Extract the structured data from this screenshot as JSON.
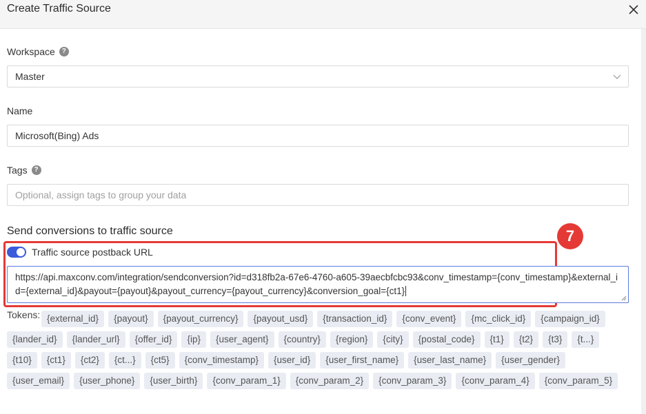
{
  "modal": {
    "title": "Create Traffic Source",
    "close_icon": "close-icon"
  },
  "workspace": {
    "label": "Workspace",
    "help_icon": "question-icon",
    "value": "Master",
    "dropdown_icon": "chevron-down-icon"
  },
  "name": {
    "label": "Name",
    "value": "Microsoft(Bing) Ads"
  },
  "tags": {
    "label": "Tags",
    "help_icon": "question-icon",
    "placeholder": "Optional, assign tags to group your data"
  },
  "conversions": {
    "section_title": "Send conversions to traffic source",
    "toggle_label": "Traffic source postback URL",
    "toggle_on": true,
    "postback_url": "https://api.maxconv.com/integration/sendconversion?id=d318fb2a-67e6-4760-a605-39aecbfcbc93&conv_timestamp={conv_timestamp}&external_id={external_id}&payout={payout}&payout_currency={payout_currency}&conversion_goal={ct1}",
    "step_badge": "7",
    "highlight_color": "#e53935",
    "accent_color": "#3b5bdb"
  },
  "tokens": {
    "label": "Tokens:",
    "items": [
      "{external_id}",
      "{payout}",
      "{payout_currency}",
      "{payout_usd}",
      "{transaction_id}",
      "{conv_event}",
      "{mc_click_id}",
      "{campaign_id}",
      "{lander_id}",
      "{lander_url}",
      "{offer_id}",
      "{ip}",
      "{user_agent}",
      "{country}",
      "{region}",
      "{city}",
      "{postal_code}",
      "{t1}",
      "{t2}",
      "{t3}",
      "{t...}",
      "{t10}",
      "{ct1}",
      "{ct2}",
      "{ct...}",
      "{ct5}",
      "{conv_timestamp}",
      "{user_id}",
      "{user_first_name}",
      "{user_last_name}",
      "{user_gender}",
      "{user_email}",
      "{user_phone}",
      "{user_birth}",
      "{conv_param_1}",
      "{conv_param_2}",
      "{conv_param_3}",
      "{conv_param_4}",
      "{conv_param_5}"
    ]
  }
}
